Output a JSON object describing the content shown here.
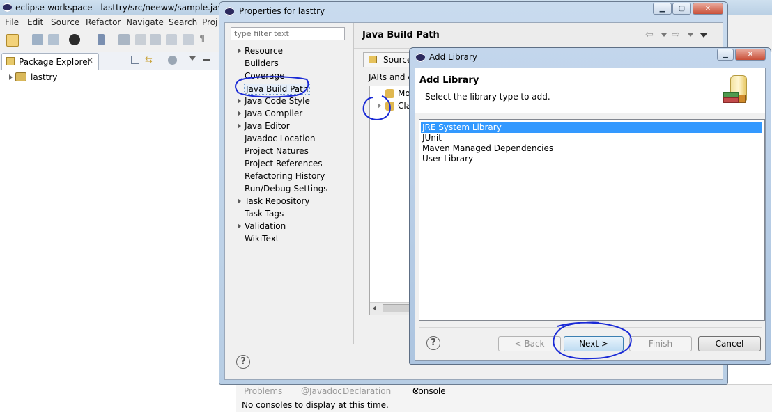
{
  "eclipse": {
    "title": "eclipse-workspace - lasttry/src/neeww/sample.java - Ec",
    "menu": [
      "File",
      "Edit",
      "Source",
      "Refactor",
      "Navigate",
      "Search",
      "Proj"
    ],
    "package_explorer": {
      "tab_label": "Package Explorer",
      "project": "lasttry"
    },
    "console": {
      "tabs": [
        "Problems",
        "Javadoc",
        "Declaration",
        "Console"
      ],
      "message": "No consoles to display at this time."
    }
  },
  "properties_dialog": {
    "title": "Properties for lasttry",
    "filter_placeholder": "type filter text",
    "nav_items": [
      {
        "label": "Resource",
        "expandable": true
      },
      {
        "label": "Builders",
        "expandable": false
      },
      {
        "label": "Coverage",
        "expandable": false
      },
      {
        "label": "Java Build Path",
        "expandable": false,
        "selected": true
      },
      {
        "label": "Java Code Style",
        "expandable": true
      },
      {
        "label": "Java Compiler",
        "expandable": true
      },
      {
        "label": "Java Editor",
        "expandable": true
      },
      {
        "label": "Javadoc Location",
        "expandable": false
      },
      {
        "label": "Project Natures",
        "expandable": false
      },
      {
        "label": "Project References",
        "expandable": false
      },
      {
        "label": "Refactoring History",
        "expandable": false
      },
      {
        "label": "Run/Debug Settings",
        "expandable": false
      },
      {
        "label": "Task Repository",
        "expandable": true
      },
      {
        "label": "Task Tags",
        "expandable": false
      },
      {
        "label": "Validation",
        "expandable": true
      },
      {
        "label": "WikiText",
        "expandable": false
      }
    ],
    "page_title": "Java Build Path",
    "source_tab": "Source",
    "jars_text": "JARs and cl",
    "classpath_rows": [
      "Mo",
      "Cla"
    ]
  },
  "add_library_dialog": {
    "title": "Add Library",
    "heading": "Add Library",
    "description": "Select the library type to add.",
    "libraries": [
      "JRE System Library",
      "JUnit",
      "Maven Managed Dependencies",
      "User Library"
    ],
    "selected_index": 0,
    "buttons": {
      "back": "< Back",
      "next": "Next >",
      "finish": "Finish",
      "cancel": "Cancel"
    }
  },
  "colors": {
    "selection": "#3399ff",
    "annotation_ink": "#1a2ad6",
    "dialog_frame": "#b7cde4"
  }
}
